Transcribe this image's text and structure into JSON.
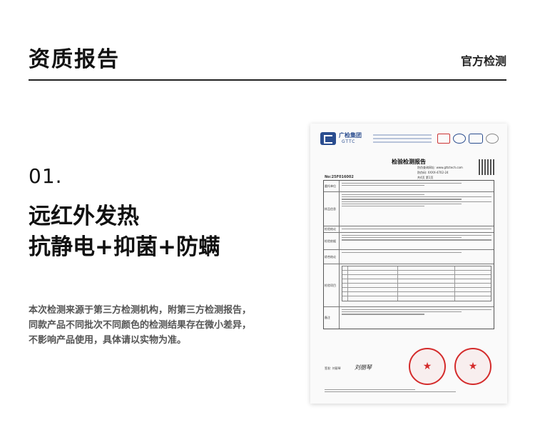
{
  "header": {
    "title": "资质报告",
    "tag": "官方检测"
  },
  "section": {
    "number": "01.",
    "headline": [
      "远红外发热",
      "抗静电+抑菌+防螨"
    ],
    "description": [
      "本次检测来源于第三方检测机构，附第三方检测报告，",
      "同款产品不同批次不同颜色的检测结果存在微小差异，",
      "不影响产品使用，具体请以实物为准。"
    ]
  },
  "certificate": {
    "org_cn": "广检集团",
    "org_en": "GTTC",
    "title": "检验检测报告",
    "report_no": "No:25F016002",
    "meta": [
      "防伪查询网址: www.gttctech.com",
      "防伪码: XXXX-4702-24",
      "共4页 第1页"
    ],
    "row_labels": [
      "委托单位",
      "样品信息",
      "检验结论",
      "检验依据",
      "综合结论",
      "检验项目",
      "备注"
    ],
    "signature_text": "签发: 刘丽琴",
    "signature_script": "刘丽琴",
    "stamp_icon": "red-star"
  }
}
